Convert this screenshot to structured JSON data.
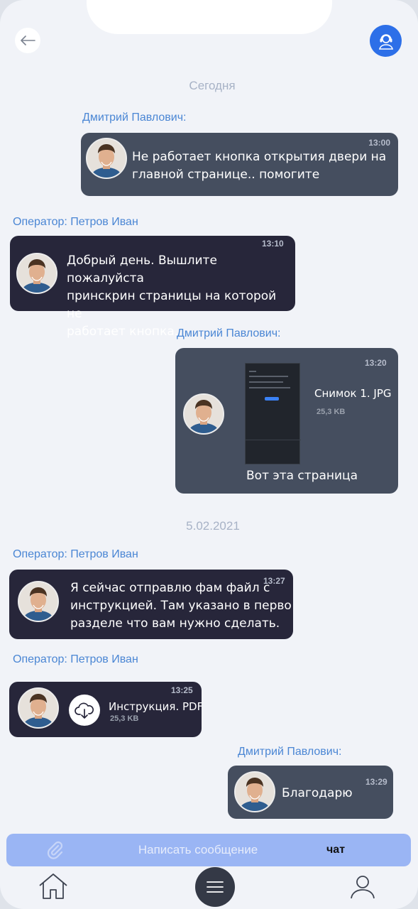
{
  "header": {
    "back_icon": "arrow-left-icon",
    "support_icon": "support-agent-icon"
  },
  "colors": {
    "accent": "#2d6fe8",
    "user_bubble": "#454e5f",
    "operator_bubble": "#27263a",
    "sender_name": "#4a86d4",
    "composer": "#9ab5f4"
  },
  "chat": {
    "date_today": "Сегодня",
    "date_second": "5.02.2021",
    "messages": [
      {
        "sender": "Дмитрий Павлович:",
        "time": "13:00",
        "lines": [
          "Не работает кнопка открытия двери на",
          "главной странице.. помогите"
        ]
      },
      {
        "sender": "Оператор: Петров Иван",
        "time": "13:10",
        "lines": [
          "Добрый день. Вышлите пожалуйста",
          "принскрин страницы на которой не",
          "работает кнопка."
        ]
      },
      {
        "sender": "Дмитрий Павлович:",
        "time": "13:20",
        "file_name": "Снимок 1. JPG",
        "file_size": "25,3 KB",
        "caption": "Вот эта страница"
      },
      {
        "sender": "Оператор: Петров Иван",
        "time": "13:27",
        "lines": [
          "Я сейчас отправлю фам файл с",
          "инструкцией. Там указано в первом",
          "разделе что вам нужно сделать."
        ]
      },
      {
        "sender": "Оператор: Петров Иван",
        "time": "13:25",
        "file_name": "Инструкция. PDF",
        "file_size": "25,3 KB",
        "file_icon": "cloud-download-icon"
      },
      {
        "sender": "Дмитрий Павлович:",
        "time": "13:29",
        "lines": [
          "Благодарю"
        ]
      }
    ]
  },
  "composer": {
    "attach_icon": "paperclip-icon",
    "placeholder": "Написать сообщение",
    "mode_label": "чат"
  },
  "bottom_nav": {
    "home_icon": "home-icon",
    "menu_icon": "menu-icon",
    "profile_icon": "profile-icon"
  }
}
